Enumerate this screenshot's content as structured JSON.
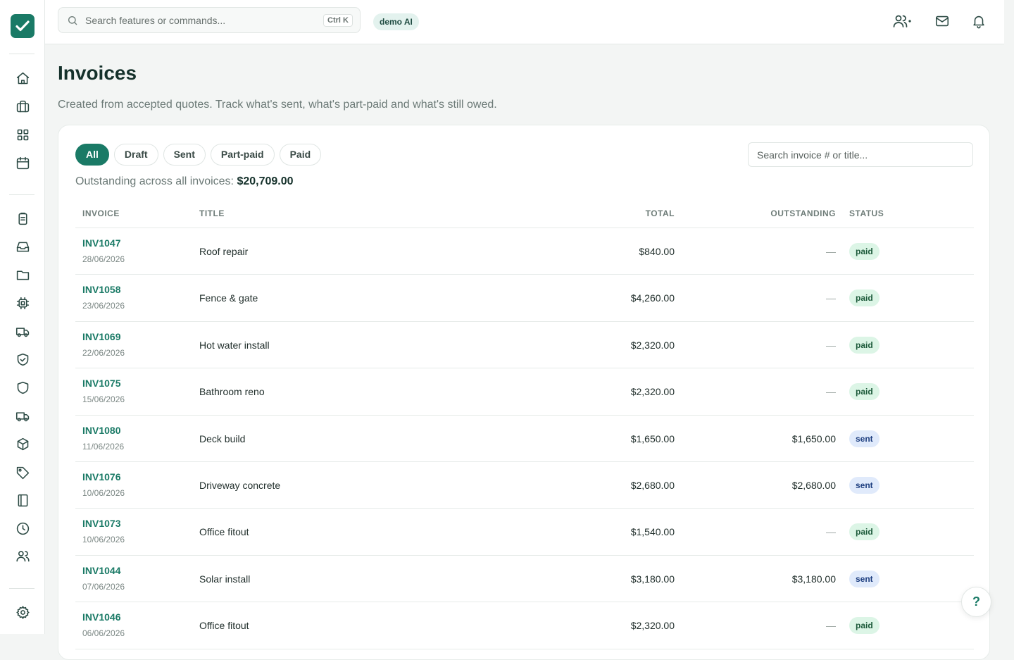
{
  "app": {
    "tenant_label": "demo AI",
    "logo_icon": "check-icon"
  },
  "search": {
    "placeholder": "Search features or commands...",
    "shortcut": "Ctrl K"
  },
  "header_icons": [
    "team-icon",
    "mail-icon",
    "bell-icon"
  ],
  "page": {
    "title": "Invoices",
    "subtitle": "Created from accepted quotes. Track what's sent, what's part-paid and what's still owed."
  },
  "filters": [
    {
      "label": "All",
      "active": true
    },
    {
      "label": "Draft",
      "active": false
    },
    {
      "label": "Sent",
      "active": false
    },
    {
      "label": "Part-paid",
      "active": false
    },
    {
      "label": "Paid",
      "active": false
    }
  ],
  "invoice_search": {
    "placeholder": "Search invoice # or title..."
  },
  "summary": {
    "label": "Outstanding across all invoices:",
    "amount": "$20,709.00"
  },
  "table": {
    "headers": {
      "invoice": "INVOICE",
      "title": "TITLE",
      "total": "TOTAL",
      "outstanding": "OUTSTANDING",
      "status": "STATUS"
    },
    "rows": [
      {
        "id": "INV1047",
        "date": "28/06/2026",
        "title": "Roof repair",
        "total": "$840.00",
        "outstanding": "—",
        "status": "paid"
      },
      {
        "id": "INV1058",
        "date": "23/06/2026",
        "title": "Fence & gate",
        "total": "$4,260.00",
        "outstanding": "—",
        "status": "paid"
      },
      {
        "id": "INV1069",
        "date": "22/06/2026",
        "title": "Hot water install",
        "total": "$2,320.00",
        "outstanding": "—",
        "status": "paid"
      },
      {
        "id": "INV1075",
        "date": "15/06/2026",
        "title": "Bathroom reno",
        "total": "$2,320.00",
        "outstanding": "—",
        "status": "paid"
      },
      {
        "id": "INV1080",
        "date": "11/06/2026",
        "title": "Deck build",
        "total": "$1,650.00",
        "outstanding": "$1,650.00",
        "status": "sent"
      },
      {
        "id": "INV1076",
        "date": "10/06/2026",
        "title": "Driveway concrete",
        "total": "$2,680.00",
        "outstanding": "$2,680.00",
        "status": "sent"
      },
      {
        "id": "INV1073",
        "date": "10/06/2026",
        "title": "Office fitout",
        "total": "$1,540.00",
        "outstanding": "—",
        "status": "paid"
      },
      {
        "id": "INV1044",
        "date": "07/06/2026",
        "title": "Solar install",
        "total": "$3,180.00",
        "outstanding": "$3,180.00",
        "status": "sent"
      },
      {
        "id": "INV1046",
        "date": "06/06/2026",
        "title": "Office fitout",
        "total": "$2,320.00",
        "outstanding": "—",
        "status": "paid"
      }
    ]
  },
  "help_label": "?",
  "sidebar_icons": [
    "home-icon",
    "briefcase-icon",
    "grid-icon",
    "calendar-icon",
    "clipboard-icon",
    "inbox-icon",
    "folder-icon",
    "chip-icon",
    "truck-icon",
    "shield-check-icon",
    "shield-icon",
    "delivery-truck-icon",
    "box-icon",
    "tag-icon",
    "book-icon",
    "clock-icon",
    "users-icon",
    "gear-icon"
  ]
}
